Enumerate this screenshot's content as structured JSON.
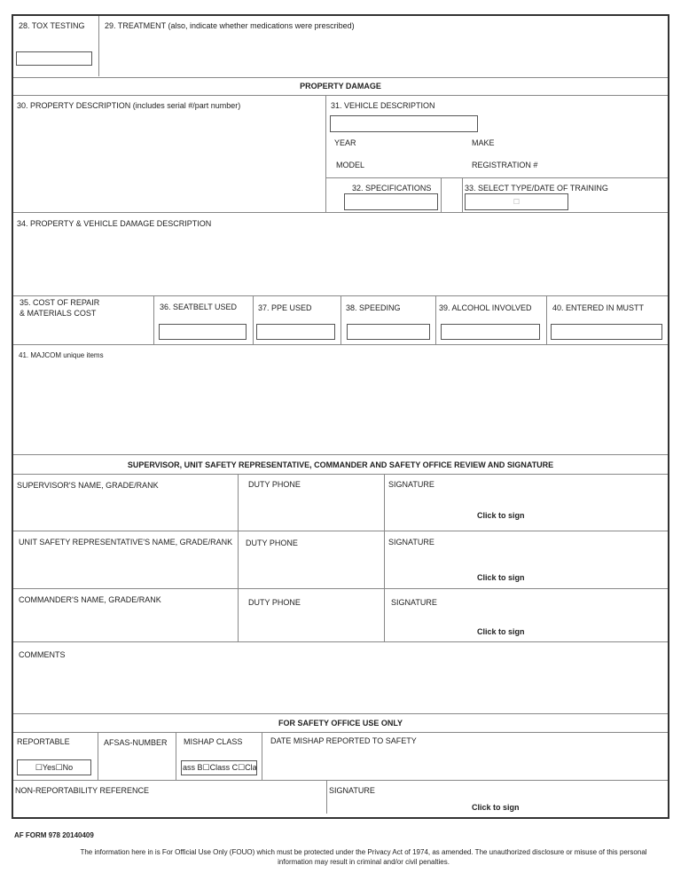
{
  "tox": {
    "label": "28. TOX TESTING"
  },
  "treatment": {
    "label": "29. TREATMENT  (also, indicate whether medications were prescribed)"
  },
  "property_damage": {
    "header": "PROPERTY DAMAGE",
    "property_description": "30. PROPERTY DESCRIPTION (includes serial #/part number)",
    "vehicle_description": "31.  VEHICLE DESCRIPTION",
    "year": "YEAR",
    "make": "MAKE",
    "model": "MODEL",
    "registration": "REGISTRATION #",
    "specifications": "32.  SPECIFICATIONS",
    "training": "33.  SELECT TYPE/DATE OF TRAINING",
    "training_checkbox": "☐",
    "damage_description": "34. PROPERTY & VEHICLE DAMAGE DESCRIPTION",
    "cost_line1": "35. COST OF REPAIR",
    "cost_line2": "& MATERIALS COST",
    "seatbelt": "36. SEATBELT USED",
    "ppe": "37. PPE USED",
    "speeding": "38. SPEEDING",
    "alcohol": "39. ALCOHOL INVOLVED",
    "mustt": "40. ENTERED IN MUSTT",
    "majcom": "41. MAJCOM unique items"
  },
  "review": {
    "header": "SUPERVISOR, UNIT SAFETY REPRESENTATIVE, COMMANDER AND SAFETY OFFICE REVIEW AND SIGNATURE",
    "rows": [
      {
        "name": "SUPERVISOR'S NAME, GRADE/RANK",
        "phone": "DUTY PHONE",
        "signature": "SIGNATURE",
        "sign": "Click to sign"
      },
      {
        "name": "UNIT SAFETY REPRESENTATIVE'S NAME, GRADE/RANK",
        "phone": "DUTY PHONE",
        "signature": "SIGNATURE",
        "sign": "Click to sign"
      },
      {
        "name": "COMMANDER'S NAME, GRADE/RANK",
        "phone": "DUTY PHONE",
        "signature": "SIGNATURE",
        "sign": "Click to sign"
      }
    ],
    "comments": "COMMENTS"
  },
  "safety_office": {
    "header": "FOR SAFETY OFFICE USE ONLY",
    "reportable": "REPORTABLE",
    "reportable_value": "☐Yes☐No",
    "afsas": "AFSAS-NUMBER",
    "mishap_class": "MISHAP CLASS",
    "mishap_class_value": "ass B☐Class C☐Clas",
    "date_reported": "DATE MISHAP REPORTED TO SAFETY",
    "non_reportability": "NON-REPORTABILITY REFERENCE",
    "signature": "SIGNATURE",
    "sign": "Click to sign"
  },
  "footer": {
    "form_id": "AF FORM 978 20140409",
    "notice": "The information here in is For Official Use Only (FOUO) which must be protected under the Privacy Act of 1974, as amended. The unauthorized disclosure or misuse of this personal information may result in criminal and/or civil penalties."
  }
}
